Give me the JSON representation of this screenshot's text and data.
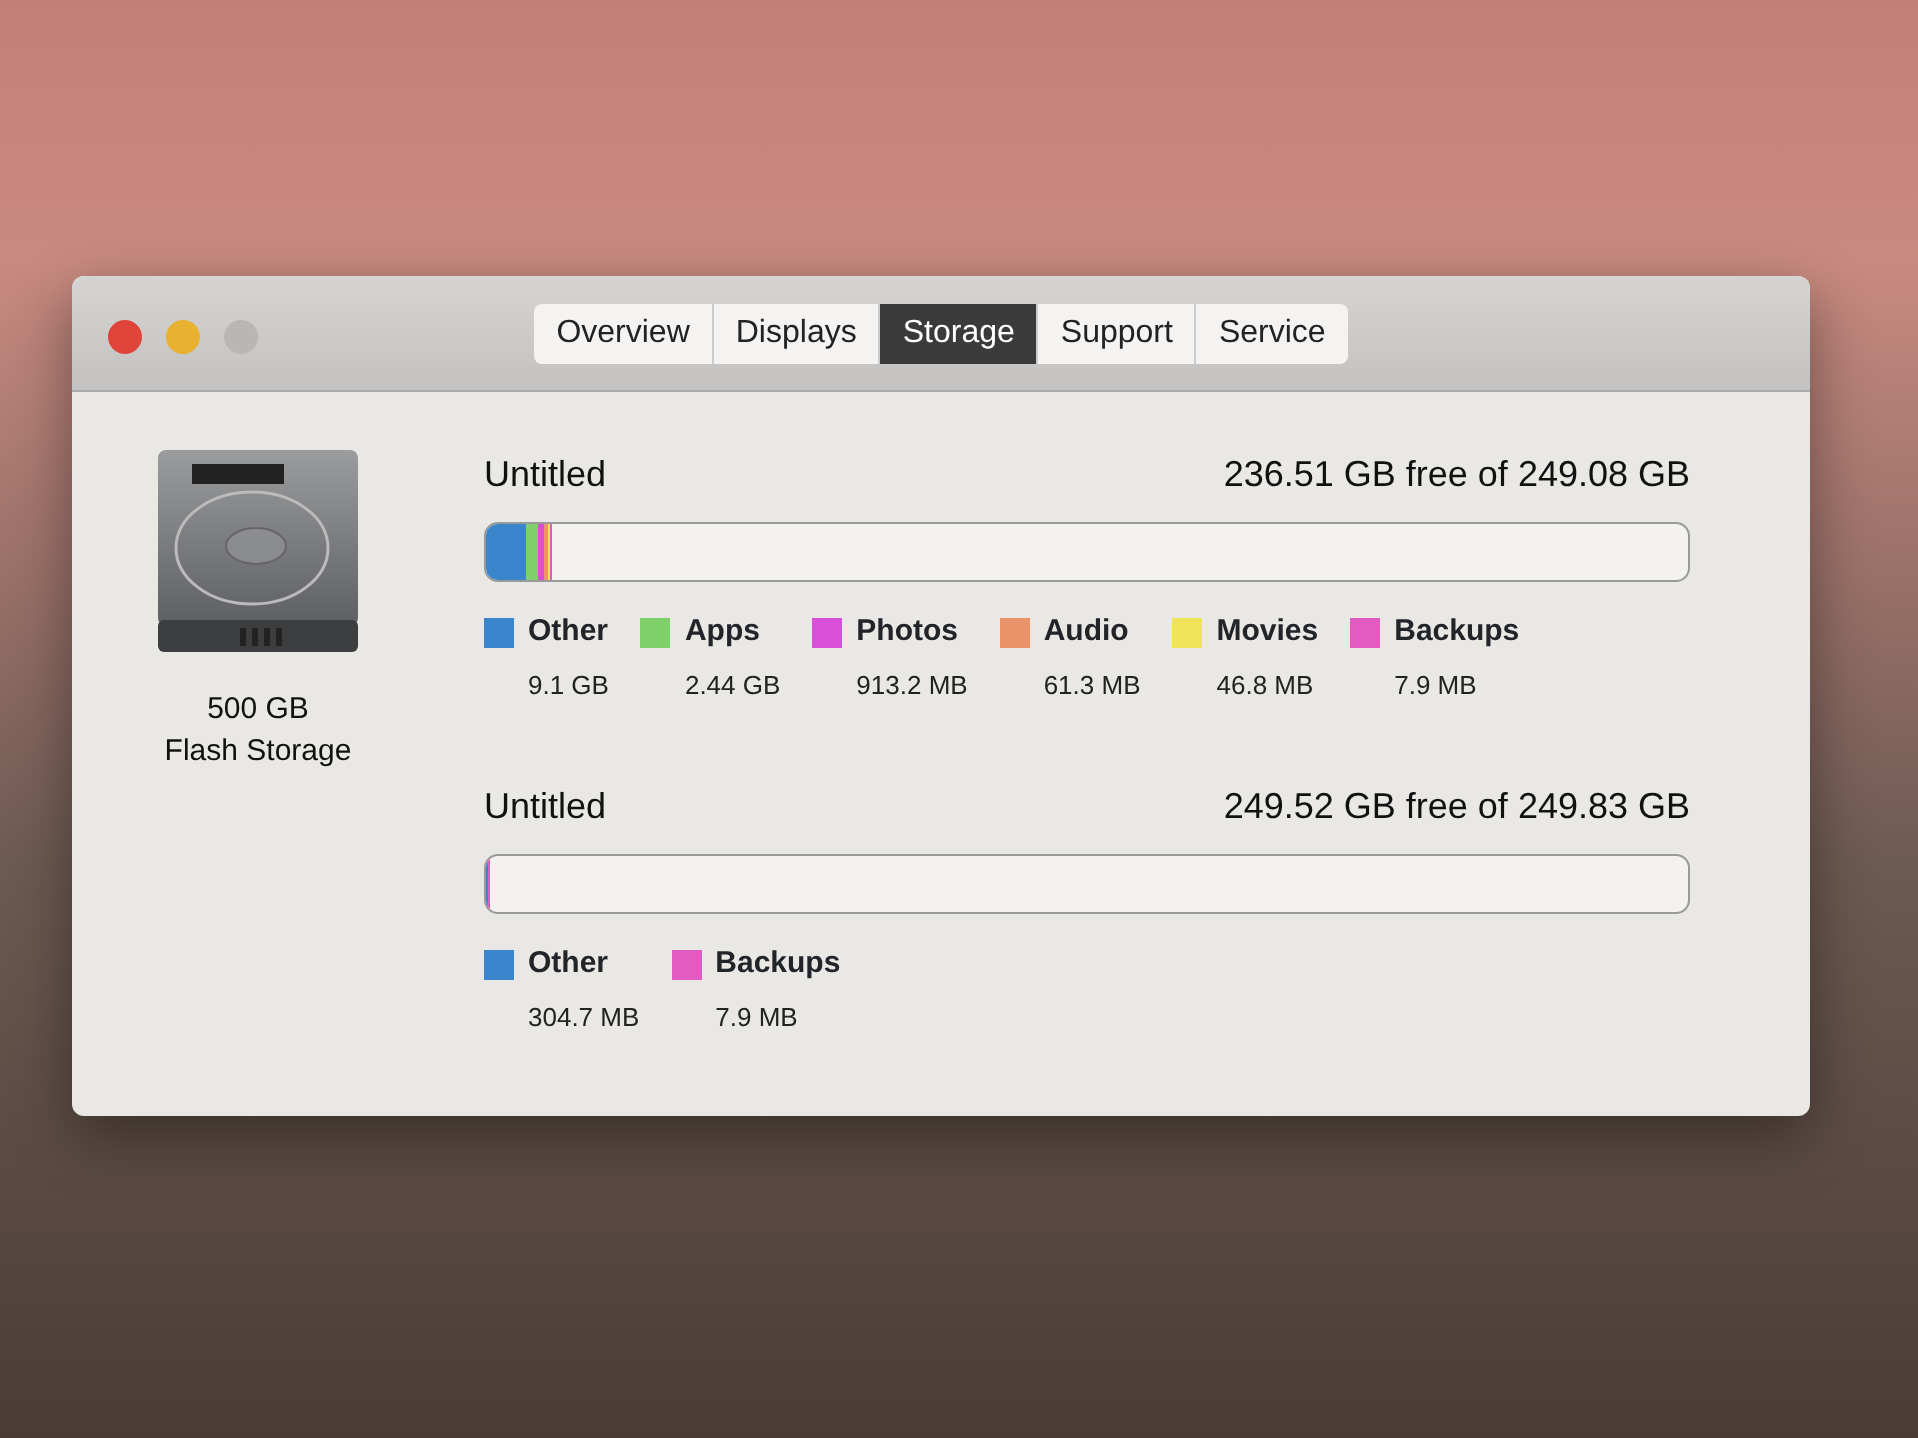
{
  "window": {
    "controls": [
      {
        "color": "#e0443a"
      },
      {
        "color": "#e8b12f"
      },
      {
        "color": "#b9b7b5"
      }
    ]
  },
  "tabs": [
    {
      "label": "Overview",
      "selected": false
    },
    {
      "label": "Displays",
      "selected": false
    },
    {
      "label": "Storage",
      "selected": true
    },
    {
      "label": "Support",
      "selected": false
    },
    {
      "label": "Service",
      "selected": false
    }
  ],
  "device": {
    "capacity": "500 GB",
    "type": "Flash Storage"
  },
  "volumes": [
    {
      "name": "Untitled",
      "free": "236.51 GB free of 249.08 GB",
      "usage_bar": [
        {
          "color": "#3a86cc",
          "level": 0.034
        },
        {
          "color": "#7fcf6a",
          "level": 0.01
        },
        {
          "color": "#d94fd8",
          "level": 0.004
        },
        {
          "color": "#e9946a",
          "level": 0.003
        },
        {
          "color": "#efe35a",
          "level": 0.002
        },
        {
          "color": "#e35ac0",
          "level": 0.001
        }
      ],
      "legend": [
        {
          "name": "Other",
          "size": "9.1 GB",
          "color": "#3a86cc"
        },
        {
          "name": "Apps",
          "size": "2.44 GB",
          "color": "#7fcf6a"
        },
        {
          "name": "Photos",
          "size": "913.2 MB",
          "color": "#d94fd8"
        },
        {
          "name": "Audio",
          "size": "61.3 MB",
          "color": "#e9946a"
        },
        {
          "name": "Movies",
          "size": "46.8 MB",
          "color": "#efe35a"
        },
        {
          "name": "Backups",
          "size": "7.9 MB",
          "color": "#e35ac0"
        }
      ]
    },
    {
      "name": "Untitled",
      "free": "249.52 GB free of 249.83 GB",
      "usage_bar": [
        {
          "color": "#3a86cc",
          "level": 0.002
        },
        {
          "color": "#e35ac0",
          "level": 0.001
        }
      ],
      "legend": [
        {
          "name": "Other",
          "size": "304.7 MB",
          "color": "#3a86cc"
        },
        {
          "name": "Backups",
          "size": "7.9 MB",
          "color": "#e35ac0"
        }
      ]
    }
  ]
}
